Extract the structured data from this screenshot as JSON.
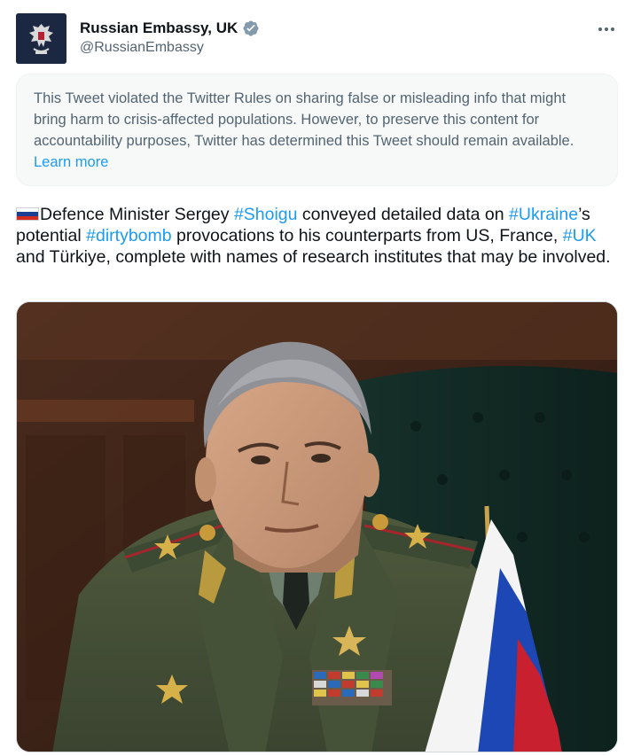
{
  "author": {
    "display_name": "Russian Embassy, UK",
    "handle": "@RussianEmbassy",
    "verified": true,
    "verified_color": "#829aab"
  },
  "notice": {
    "text": "This Tweet violated the Twitter Rules on sharing false or misleading info that might bring harm to crisis-affected populations. However, to preserve this content for accountability purposes, Twitter has determined this Tweet should remain available.",
    "link_label": "Learn more"
  },
  "tweet": {
    "segments": [
      {
        "text": "Defence Minister Sergey ",
        "hashtag": false
      },
      {
        "text": "#Shoigu",
        "hashtag": true
      },
      {
        "text": " conveyed detailed data on ",
        "hashtag": false
      },
      {
        "text": "#Ukraine",
        "hashtag": true
      },
      {
        "text": "’s potential ",
        "hashtag": false
      },
      {
        "text": "#dirtybomb",
        "hashtag": true
      },
      {
        "text": " provocations to his counterparts from US, France, ",
        "hashtag": false
      },
      {
        "text": "#UK",
        "hashtag": true
      },
      {
        "text": " and Türkiye, complete with names of research institutes that may be involved.",
        "hashtag": false
      }
    ],
    "leading_emoji": "russia-flag-icon"
  },
  "colors": {
    "link": "#1d9bf0",
    "secondary_text": "#536471"
  }
}
